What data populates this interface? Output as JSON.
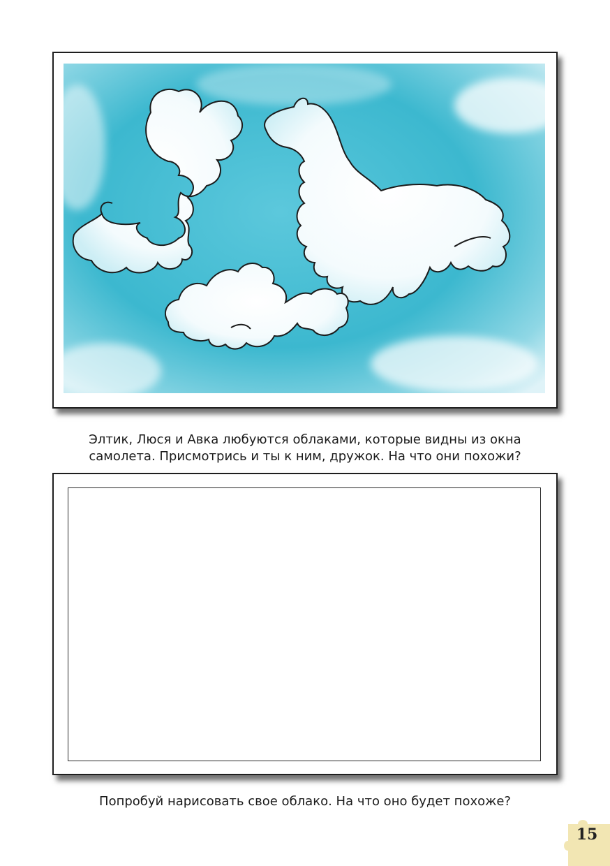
{
  "illustration": {
    "subject": "sky-with-clouds",
    "sky_color": "#3fbad0",
    "cloud_color": "#ffffff",
    "cloud_shapes": [
      "bow-cloud",
      "giraffe-cloud",
      "fish-cloud"
    ]
  },
  "captions": {
    "top_line1": "Элтик, Люся и Авка любуются облаками, которые видны из окна",
    "top_line2": "самолета. Присмотрись и ты к ним, дружок. На что они похожи?",
    "bottom": "Попробуй нарисовать свое облако. На что оно будет похоже?"
  },
  "page": {
    "number": "15",
    "badge_color": "#f2e6b3"
  }
}
